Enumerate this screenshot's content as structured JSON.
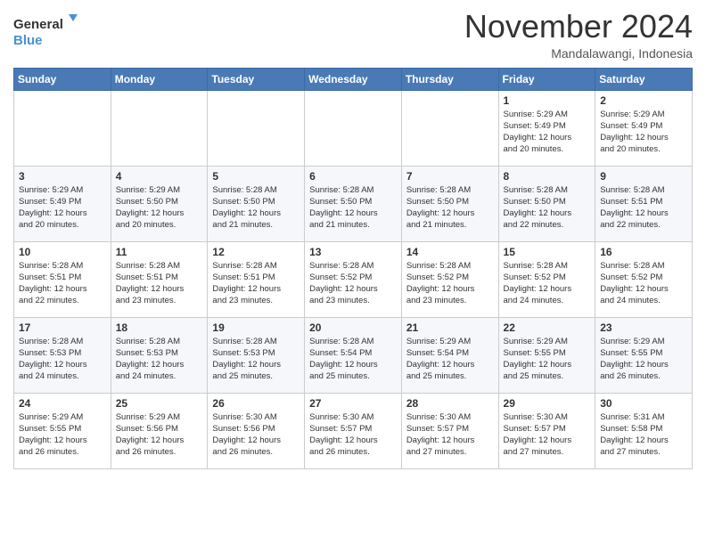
{
  "header": {
    "logo_line1": "General",
    "logo_line2": "Blue",
    "month_title": "November 2024",
    "location": "Mandalawangi, Indonesia"
  },
  "weekdays": [
    "Sunday",
    "Monday",
    "Tuesday",
    "Wednesday",
    "Thursday",
    "Friday",
    "Saturday"
  ],
  "weeks": [
    [
      {
        "day": "",
        "info": ""
      },
      {
        "day": "",
        "info": ""
      },
      {
        "day": "",
        "info": ""
      },
      {
        "day": "",
        "info": ""
      },
      {
        "day": "",
        "info": ""
      },
      {
        "day": "1",
        "info": "Sunrise: 5:29 AM\nSunset: 5:49 PM\nDaylight: 12 hours\nand 20 minutes."
      },
      {
        "day": "2",
        "info": "Sunrise: 5:29 AM\nSunset: 5:49 PM\nDaylight: 12 hours\nand 20 minutes."
      }
    ],
    [
      {
        "day": "3",
        "info": "Sunrise: 5:29 AM\nSunset: 5:49 PM\nDaylight: 12 hours\nand 20 minutes."
      },
      {
        "day": "4",
        "info": "Sunrise: 5:29 AM\nSunset: 5:50 PM\nDaylight: 12 hours\nand 20 minutes."
      },
      {
        "day": "5",
        "info": "Sunrise: 5:28 AM\nSunset: 5:50 PM\nDaylight: 12 hours\nand 21 minutes."
      },
      {
        "day": "6",
        "info": "Sunrise: 5:28 AM\nSunset: 5:50 PM\nDaylight: 12 hours\nand 21 minutes."
      },
      {
        "day": "7",
        "info": "Sunrise: 5:28 AM\nSunset: 5:50 PM\nDaylight: 12 hours\nand 21 minutes."
      },
      {
        "day": "8",
        "info": "Sunrise: 5:28 AM\nSunset: 5:50 PM\nDaylight: 12 hours\nand 22 minutes."
      },
      {
        "day": "9",
        "info": "Sunrise: 5:28 AM\nSunset: 5:51 PM\nDaylight: 12 hours\nand 22 minutes."
      }
    ],
    [
      {
        "day": "10",
        "info": "Sunrise: 5:28 AM\nSunset: 5:51 PM\nDaylight: 12 hours\nand 22 minutes."
      },
      {
        "day": "11",
        "info": "Sunrise: 5:28 AM\nSunset: 5:51 PM\nDaylight: 12 hours\nand 23 minutes."
      },
      {
        "day": "12",
        "info": "Sunrise: 5:28 AM\nSunset: 5:51 PM\nDaylight: 12 hours\nand 23 minutes."
      },
      {
        "day": "13",
        "info": "Sunrise: 5:28 AM\nSunset: 5:52 PM\nDaylight: 12 hours\nand 23 minutes."
      },
      {
        "day": "14",
        "info": "Sunrise: 5:28 AM\nSunset: 5:52 PM\nDaylight: 12 hours\nand 23 minutes."
      },
      {
        "day": "15",
        "info": "Sunrise: 5:28 AM\nSunset: 5:52 PM\nDaylight: 12 hours\nand 24 minutes."
      },
      {
        "day": "16",
        "info": "Sunrise: 5:28 AM\nSunset: 5:52 PM\nDaylight: 12 hours\nand 24 minutes."
      }
    ],
    [
      {
        "day": "17",
        "info": "Sunrise: 5:28 AM\nSunset: 5:53 PM\nDaylight: 12 hours\nand 24 minutes."
      },
      {
        "day": "18",
        "info": "Sunrise: 5:28 AM\nSunset: 5:53 PM\nDaylight: 12 hours\nand 24 minutes."
      },
      {
        "day": "19",
        "info": "Sunrise: 5:28 AM\nSunset: 5:53 PM\nDaylight: 12 hours\nand 25 minutes."
      },
      {
        "day": "20",
        "info": "Sunrise: 5:28 AM\nSunset: 5:54 PM\nDaylight: 12 hours\nand 25 minutes."
      },
      {
        "day": "21",
        "info": "Sunrise: 5:29 AM\nSunset: 5:54 PM\nDaylight: 12 hours\nand 25 minutes."
      },
      {
        "day": "22",
        "info": "Sunrise: 5:29 AM\nSunset: 5:55 PM\nDaylight: 12 hours\nand 25 minutes."
      },
      {
        "day": "23",
        "info": "Sunrise: 5:29 AM\nSunset: 5:55 PM\nDaylight: 12 hours\nand 26 minutes."
      }
    ],
    [
      {
        "day": "24",
        "info": "Sunrise: 5:29 AM\nSunset: 5:55 PM\nDaylight: 12 hours\nand 26 minutes."
      },
      {
        "day": "25",
        "info": "Sunrise: 5:29 AM\nSunset: 5:56 PM\nDaylight: 12 hours\nand 26 minutes."
      },
      {
        "day": "26",
        "info": "Sunrise: 5:30 AM\nSunset: 5:56 PM\nDaylight: 12 hours\nand 26 minutes."
      },
      {
        "day": "27",
        "info": "Sunrise: 5:30 AM\nSunset: 5:57 PM\nDaylight: 12 hours\nand 26 minutes."
      },
      {
        "day": "28",
        "info": "Sunrise: 5:30 AM\nSunset: 5:57 PM\nDaylight: 12 hours\nand 27 minutes."
      },
      {
        "day": "29",
        "info": "Sunrise: 5:30 AM\nSunset: 5:57 PM\nDaylight: 12 hours\nand 27 minutes."
      },
      {
        "day": "30",
        "info": "Sunrise: 5:31 AM\nSunset: 5:58 PM\nDaylight: 12 hours\nand 27 minutes."
      }
    ]
  ]
}
